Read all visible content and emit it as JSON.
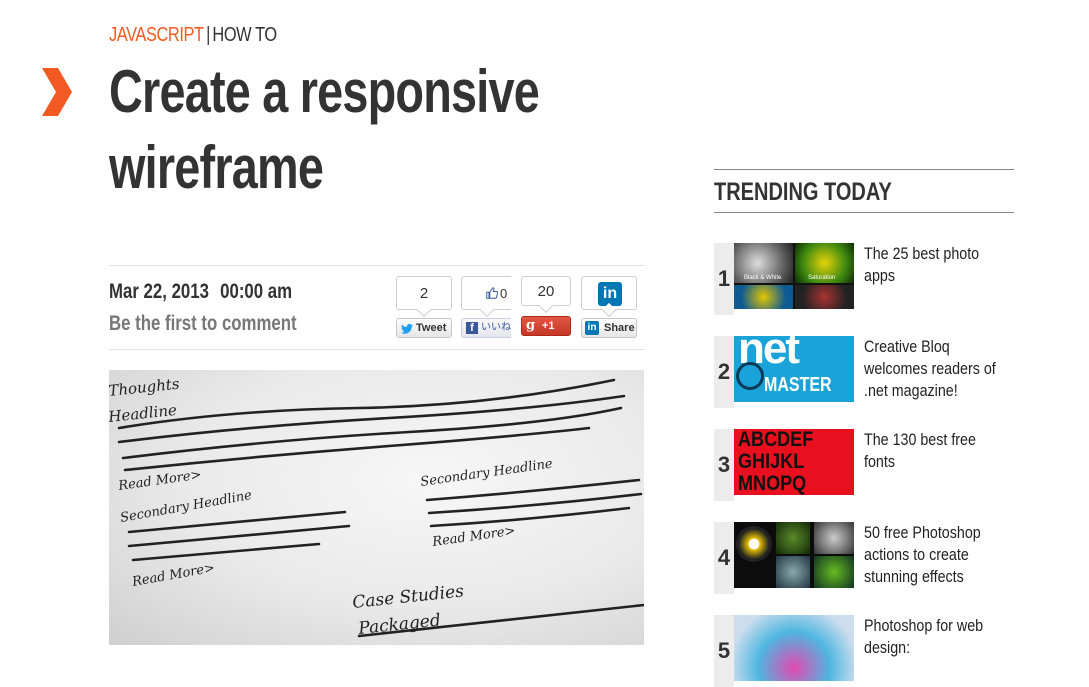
{
  "article": {
    "category_primary": "JAVASCRIPT",
    "separator": "|",
    "category_secondary": "HOW TO",
    "title_line1": "Create a responsive",
    "title_line2": "wireframe",
    "date": "Mar 22, 2013",
    "time": "00:00 am",
    "comment_link": "Be the first to comment"
  },
  "share": {
    "tweet_count": "2",
    "tweet_label": "Tweet",
    "fb_count": "0",
    "fb_label": "いいね",
    "gplus_count": "20",
    "gplus_label": "+1",
    "linkedin_label": "Share"
  },
  "hero_image": {
    "handwriting": [
      "Thoughts",
      "Headline",
      "Read More>",
      "Secondary Headline",
      "Read More>",
      "Secondary Headline",
      "Read More>",
      "Case Studies",
      "Packaged"
    ]
  },
  "sidebar": {
    "title": "TRENDING TODAY",
    "items": [
      {
        "rank": "1",
        "title": "The 25 best photo apps",
        "thumb_labels": [
          "Black & White",
          "Saturation"
        ]
      },
      {
        "rank": "2",
        "title": "Creative Bloq welcomes readers of .net magazine!",
        "thumb_labels": [
          "net",
          "MASTER"
        ]
      },
      {
        "rank": "3",
        "title": "The 130 best free fonts",
        "thumb_labels": [
          "ABCDEF",
          "GHIJKL",
          "MNOPQ"
        ]
      },
      {
        "rank": "4",
        "title": "50 free Photoshop actions to create stunning effects",
        "thumb_labels": []
      },
      {
        "rank": "5",
        "title": "Photoshop for web design:",
        "thumb_labels": []
      }
    ]
  },
  "colors": {
    "accent": "#f15a22",
    "text": "#333333",
    "muted": "#777777",
    "twitter": "#1da1f2",
    "facebook": "#3b5998",
    "gplus": "#dd4b39",
    "linkedin": "#0077b5"
  }
}
